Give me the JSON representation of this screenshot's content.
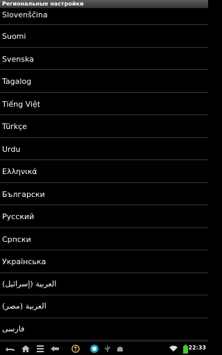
{
  "window": {
    "title": "Региональные настройки"
  },
  "languages": [
    "Slovenščina",
    "Suomi",
    "Svenska",
    "Tagalog",
    "Tiếng Việt",
    "Türkçe",
    "Urdu",
    "Ελληνικά",
    "Български",
    "Русский",
    "Српски",
    "Українська",
    "العربية (إسرائيل)",
    "العربية (مصر)",
    "فارسی"
  ],
  "status_bar": {
    "time": "22:33",
    "icons": [
      "back-icon",
      "home-icon",
      "recent-apps-icon",
      "menu-icon",
      "usb-debug-icon",
      "android-icon",
      "wifi-icon",
      "battery-icon"
    ]
  },
  "colors": {
    "background": "#000000",
    "text": "#ffffff",
    "divider": "#3a3a3a",
    "battery": "#4cc23a",
    "accent": "#33b5e5"
  }
}
